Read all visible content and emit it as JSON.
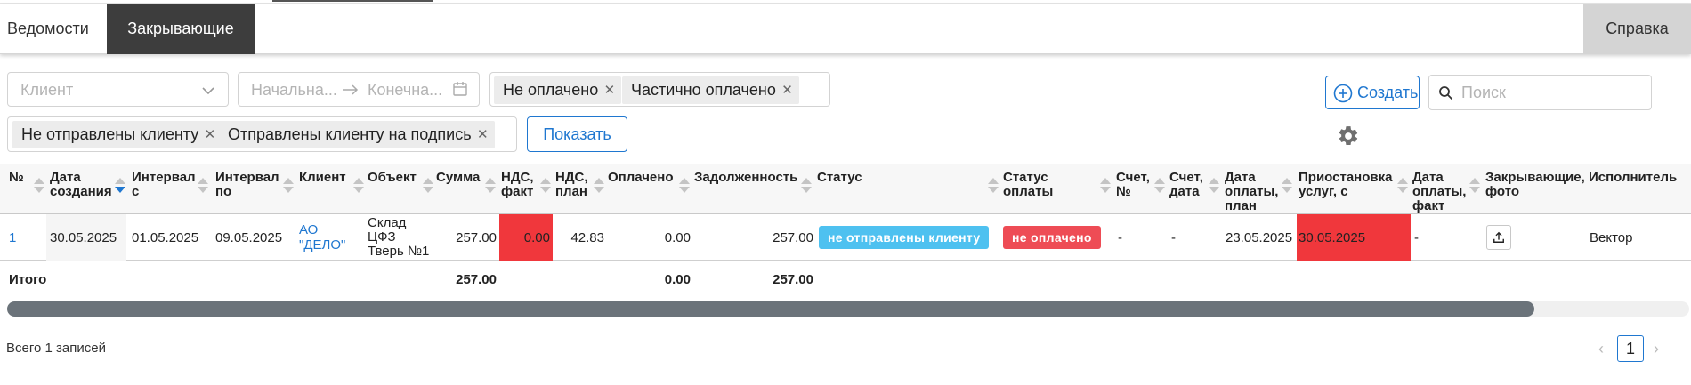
{
  "nav": {
    "tabs": [
      {
        "label": "Ведомости",
        "active": false
      },
      {
        "label": "Закрывающие",
        "active": true
      }
    ],
    "help_label": "Справка"
  },
  "filters": {
    "client_placeholder": "Клиент",
    "date_start_placeholder": "Начальна...",
    "date_end_placeholder": "Конечна...",
    "payment_tags": [
      "Не оплачено",
      "Частично оплачено"
    ],
    "send_tags": [
      "Не отправлены клиенту",
      "Отправлены клиенту на подпись"
    ],
    "show_label": "Показать",
    "create_label": "Создать",
    "search_placeholder": "Поиск"
  },
  "table": {
    "headers": {
      "num": "№",
      "created": [
        "Дата",
        "создания"
      ],
      "from": [
        "Интервал",
        "с"
      ],
      "to": [
        "Интервал",
        "по"
      ],
      "client": "Клиент",
      "object": "Объект",
      "sum": "Сумма",
      "vat_fact": [
        "НДС,",
        "факт"
      ],
      "vat_plan": [
        "НДС,",
        "план"
      ],
      "paid": "Оплачено",
      "debt": "Задолженность",
      "status": "Статус",
      "pay_status": [
        "Статус",
        "оплаты"
      ],
      "inv_num": [
        "Счет,",
        "№"
      ],
      "inv_date": [
        "Счет,",
        "дата"
      ],
      "pay_plan": [
        "Дата",
        "оплаты,",
        "план"
      ],
      "suspend": [
        "Приостановка",
        "услуг, с"
      ],
      "pay_fact": [
        "Дата",
        "оплаты,",
        "факт"
      ],
      "closing_photo": [
        "Закрывающие,",
        "фото"
      ],
      "executor": "Исполнитель"
    },
    "rows": [
      {
        "num": "1",
        "created": "30.05.2025",
        "from": "01.05.2025",
        "to": "09.05.2025",
        "client": [
          "АО",
          "\"ДЕЛО\""
        ],
        "object": [
          "Склад",
          "ЦФЗ",
          "Тверь №1"
        ],
        "sum": "257.00",
        "vat_fact": "0.00",
        "vat_plan": "42.83",
        "paid": "0.00",
        "debt": "257.00",
        "status": "не отправлены клиенту",
        "pay_status": "не оплачено",
        "inv_num": "-",
        "inv_date": "-",
        "pay_plan": "23.05.2025",
        "suspend": "30.05.2025",
        "pay_fact": "-",
        "executor": "Вектор"
      }
    ],
    "totals": {
      "label": "Итого",
      "sum": "257.00",
      "paid": "0.00",
      "debt": "257.00"
    }
  },
  "footer": {
    "total_records": "Всего 1 записей",
    "current_page": "1"
  },
  "colors": {
    "accent": "#1f77d0",
    "status_badge": "#4ec1f0",
    "pay_badge": "#ee4c55",
    "alert_cell": "#f0373c"
  }
}
